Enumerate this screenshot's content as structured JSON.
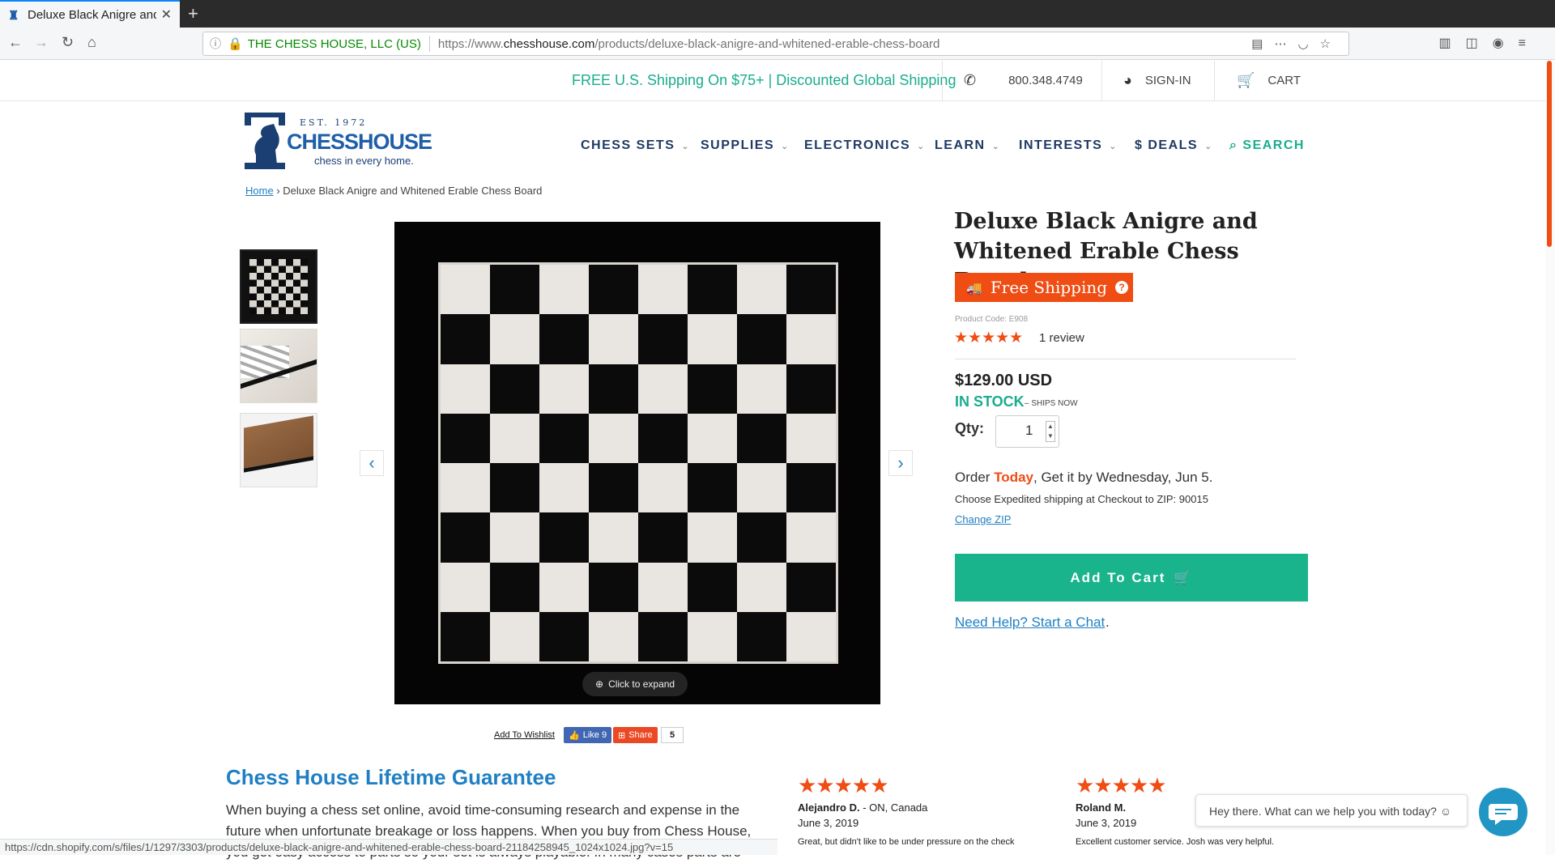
{
  "browser": {
    "tab_title": "Deluxe Black Anigre and Whitened",
    "tab_close": "✕",
    "new_tab": "+",
    "url_org": "THE CHESS HOUSE, LLC (US)",
    "url_prefix": "https://www.",
    "url_domain": "chesshouse.com",
    "url_path": "/products/deluxe-black-anigre-and-whitened-erable-chess-board",
    "status_url": "https://cdn.shopify.com/s/files/1/1297/3303/products/deluxe-black-anigre-and-whitened-erable-chess-board-21184258945_1024x1024.jpg?v=15"
  },
  "topstrip": {
    "promo": "FREE U.S. Shipping On $75+ | Discounted Global Shipping",
    "phone": "800.348.4749",
    "signin": "SIGN-IN",
    "cart": "CART"
  },
  "logo": {
    "est": "EST. 1972",
    "brand": "CHESSHOUSE",
    "tagline": "chess in every home."
  },
  "nav": {
    "items": [
      {
        "label": "CHESS SETS"
      },
      {
        "label": "SUPPLIES"
      },
      {
        "label": "ELECTRONICS"
      },
      {
        "label": "LEARN"
      },
      {
        "label": "INTERESTS"
      },
      {
        "label": "$ DEALS"
      }
    ],
    "search": "SEARCH"
  },
  "breadcrumb": {
    "home": "Home",
    "separator": "›",
    "current": "Deluxe Black Anigre and Whitened Erable Chess Board"
  },
  "gallery": {
    "expand_label": "Click to expand",
    "prev": "‹",
    "next": "›"
  },
  "social": {
    "wishlist": "Add To Wishlist",
    "like": "Like 9",
    "share": "Share",
    "share_count": "5"
  },
  "product": {
    "title": "Deluxe Black Anigre and Whitened Erable Chess Board",
    "free_shipping": "Free Shipping",
    "code": "Product Code: E908",
    "rating": 5,
    "reviews": "1 review",
    "price": "$129.00 USD",
    "stock": "IN STOCK",
    "ships": "– SHIPS NOW",
    "qty_label": "Qty:",
    "qty_value": "1",
    "order_prefix": "Order ",
    "order_today": "Today",
    "order_suffix": ", Get it by Wednesday, Jun 5.",
    "expedited": "Choose Expedited shipping at Checkout to ZIP: 90015",
    "change_zip": "Change ZIP",
    "add_to_cart": "Add To Cart",
    "need_help": "Need Help? Start a Chat"
  },
  "guarantee": {
    "heading": "Chess House Lifetime Guarantee",
    "text": "When buying a chess set online, avoid time-consuming research and expense in the future when unfortunate breakage or loss happens. When you buy from Chess House, you get easy access to parts so your set is always playable. In many cases parts are"
  },
  "reviews": [
    {
      "name": "Alejandro D.",
      "location": " - ON, Canada",
      "date": "June 3, 2019",
      "text": "Great, but didn't like to be under pressure on the check"
    },
    {
      "name": "Roland M.",
      "location": "",
      "date": "June 3, 2019",
      "text": "Excellent customer service. Josh was very helpful."
    }
  ],
  "chat": {
    "prompt": "Hey there. What can we help you with today? ☺"
  },
  "colors": {
    "accent_green": "#19b38c",
    "accent_orange": "#ef4d14",
    "link_blue": "#1f7fc4",
    "nav_navy": "#1e3a64"
  }
}
